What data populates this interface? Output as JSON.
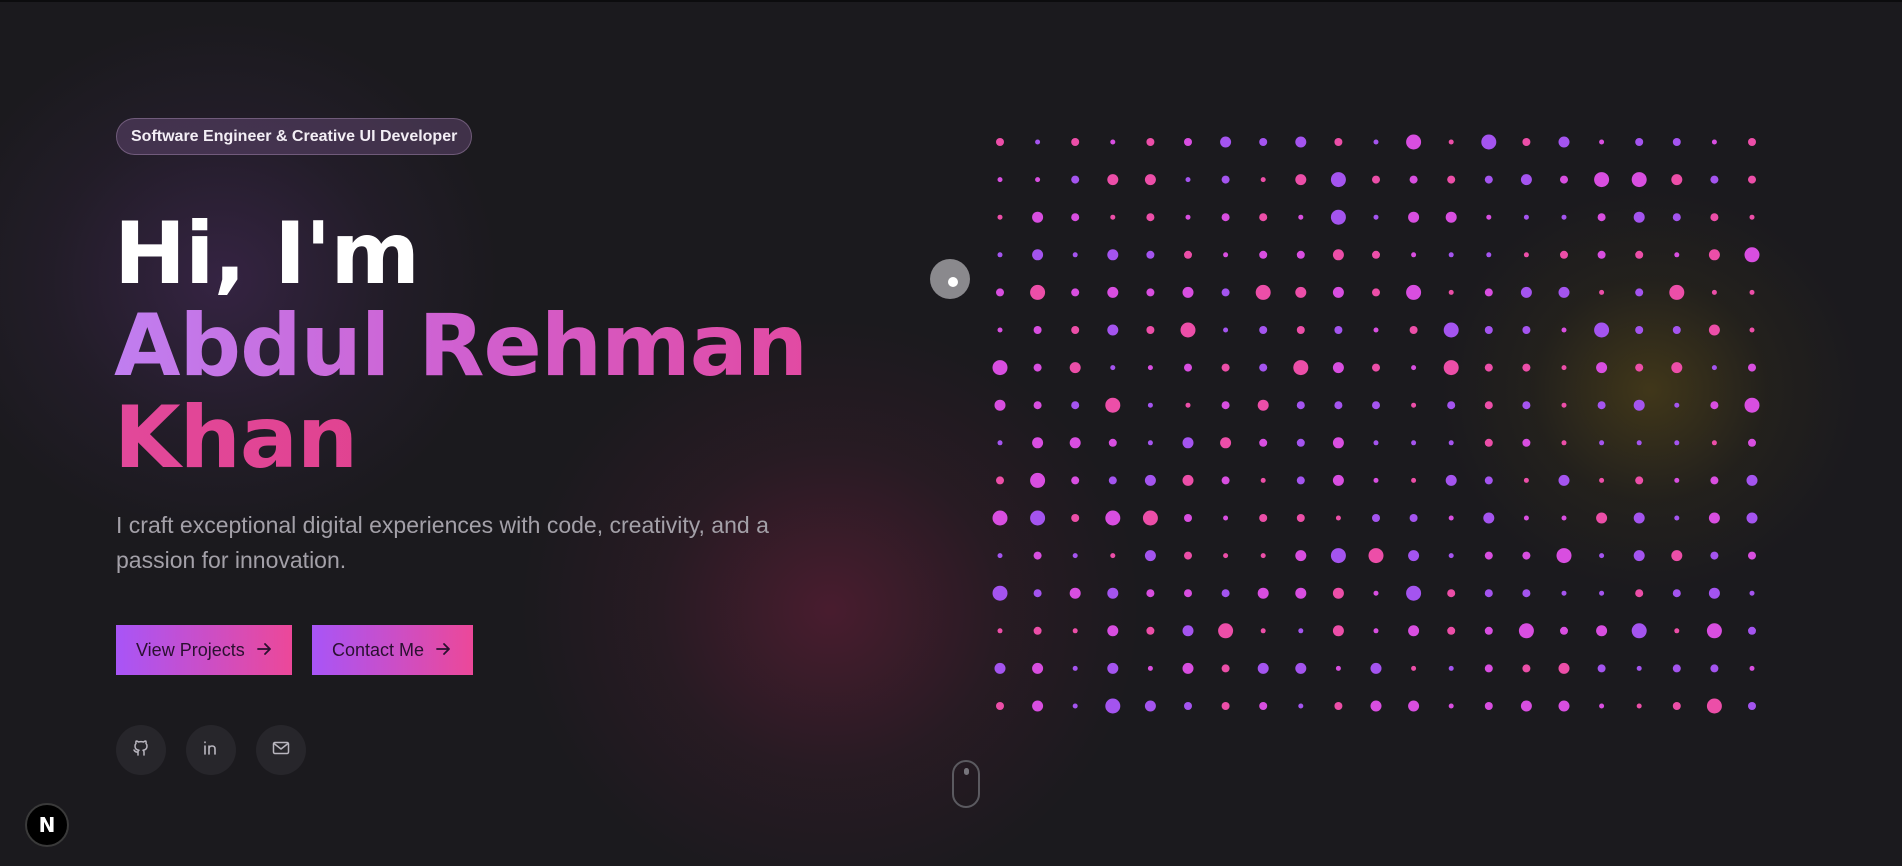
{
  "hero": {
    "badge": "Software Engineer & Creative UI Developer",
    "greeting": "Hi, I'm",
    "name_line1": "Abdul Rehman",
    "name_line2": "Khan",
    "subtitle_line1": "I craft exceptional digital experiences with code, creativity, and a",
    "subtitle_line2": "passion for innovation."
  },
  "buttons": {
    "projects": {
      "label": "View Projects",
      "icon": "arrow-right-icon"
    },
    "contact": {
      "label": "Contact Me",
      "icon": "arrow-right-icon"
    }
  },
  "social": [
    {
      "name": "github",
      "icon": "github-icon"
    },
    {
      "name": "linkedin",
      "icon": "linkedin-icon"
    },
    {
      "name": "mail",
      "icon": "mail-icon"
    }
  ],
  "dev_indicator": {
    "label": "N"
  },
  "colors": {
    "background": "#1b1a1e",
    "accent_start": "#a855f7",
    "accent_end": "#ec4899",
    "dot_purple": "#a454ef",
    "dot_pink": "#ec4ea8",
    "dot_magenta": "#d84ee0"
  }
}
